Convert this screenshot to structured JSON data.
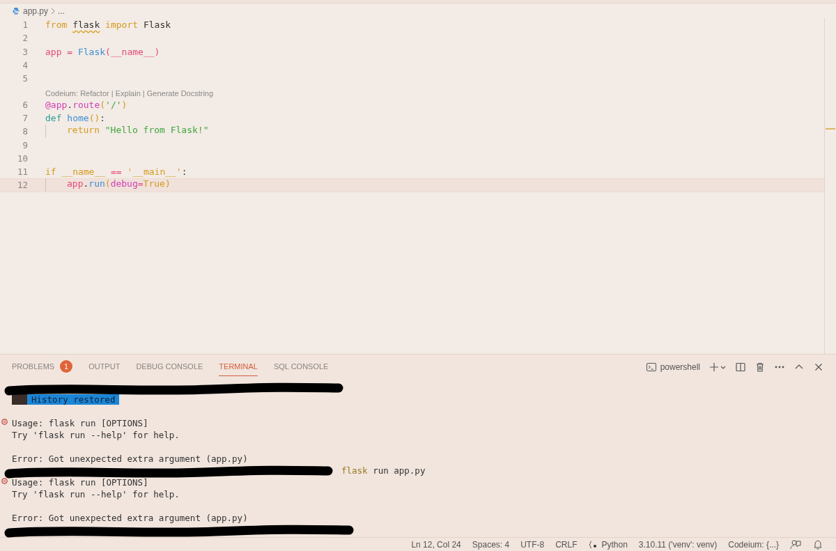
{
  "breadcrumb": {
    "file": "app.py",
    "rest": "..."
  },
  "editor": {
    "lines": [
      {
        "number": "1",
        "current": false,
        "tokens": [
          {
            "text": "from ",
            "kind": "keyword"
          },
          {
            "text": "flask",
            "kind": "warn"
          },
          {
            "text": " import ",
            "kind": "keyword"
          },
          {
            "text": "Flask",
            "kind": "plain"
          }
        ]
      },
      {
        "number": "2",
        "current": false
      },
      {
        "number": "3",
        "current": false,
        "tokens": [
          {
            "text": "app",
            "kind": "var"
          },
          {
            "text": " = ",
            "kind": "op"
          },
          {
            "text": "Flask",
            "kind": "class"
          },
          {
            "text": "(__name__)",
            "kind": "var"
          }
        ]
      },
      {
        "number": "4",
        "current": false
      },
      {
        "number": "5",
        "current": false
      },
      {
        "number": "6",
        "current": false,
        "codelens": "Codeium: Refactor | Explain | Generate Docstring",
        "tokens": [
          {
            "text": "@app",
            "kind": "decorator"
          },
          {
            "text": ".",
            "kind": "plain"
          },
          {
            "text": "route",
            "kind": "decorator"
          },
          {
            "text": "(",
            "kind": "paren"
          },
          {
            "text": "'/'",
            "kind": "string"
          },
          {
            "text": ")",
            "kind": "paren"
          }
        ]
      },
      {
        "number": "7",
        "current": false,
        "tokens": [
          {
            "text": "def ",
            "kind": "def"
          },
          {
            "text": "home",
            "kind": "func"
          },
          {
            "text": "()",
            "kind": "paren"
          },
          {
            "text": ":",
            "kind": "plain"
          }
        ]
      },
      {
        "number": "8",
        "current": false,
        "tokens": [
          {
            "kind": "indent"
          },
          {
            "text": "return ",
            "kind": "keyword"
          },
          {
            "text": "\"Hello from Flask!\"",
            "kind": "string"
          }
        ]
      },
      {
        "number": "9",
        "current": false
      },
      {
        "number": "10",
        "current": false
      },
      {
        "number": "11",
        "current": false,
        "tokens": [
          {
            "text": "if ",
            "kind": "keyword"
          },
          {
            "text": "__name__",
            "kind": "keyword"
          },
          {
            "text": " == ",
            "kind": "op"
          },
          {
            "text": "'__main__'",
            "kind": "keyword"
          },
          {
            "text": ":",
            "kind": "plain"
          }
        ]
      },
      {
        "number": "12",
        "current": true,
        "tokens": [
          {
            "kind": "indent"
          },
          {
            "text": "app",
            "kind": "var"
          },
          {
            "text": ".",
            "kind": "plain"
          },
          {
            "text": "run",
            "kind": "class"
          },
          {
            "text": "(",
            "kind": "paren"
          },
          {
            "text": "debug",
            "kind": "decorator"
          },
          {
            "text": "=",
            "kind": "op"
          },
          {
            "text": "True",
            "kind": "keyword"
          },
          {
            "text": ")",
            "kind": "paren"
          }
        ]
      }
    ]
  },
  "panel": {
    "tabs": [
      {
        "label": "PROBLEMS",
        "selected": false,
        "badge": "1"
      },
      {
        "label": "OUTPUT",
        "selected": false
      },
      {
        "label": "DEBUG CONSOLE",
        "selected": false
      },
      {
        "label": "TERMINAL",
        "selected": true
      },
      {
        "label": "SQL CONSOLE",
        "selected": false
      }
    ],
    "shell": "powershell",
    "terminal": [
      {
        "kind": "redacted"
      },
      {
        "kind": "notice",
        "text": "History restored"
      },
      {
        "kind": "blank"
      },
      {
        "kind": "error",
        "text": "Usage: flask run [OPTIONS]"
      },
      {
        "kind": "text",
        "text": "Try 'flask run --help' for help."
      },
      {
        "kind": "blank"
      },
      {
        "kind": "text",
        "text": "Error: Got unexpected extra argument (app.py)"
      },
      {
        "kind": "redacted",
        "tail": "flask run app.py"
      },
      {
        "kind": "error",
        "text": "Usage: flask run [OPTIONS]"
      },
      {
        "kind": "text",
        "text": "Try 'flask run --help' for help."
      },
      {
        "kind": "blank"
      },
      {
        "kind": "text",
        "text": "Error: Got unexpected extra argument (app.py)"
      },
      {
        "kind": "redacted"
      }
    ]
  },
  "status_bar": [
    "Ln 12, Col 24",
    "Spaces: 4",
    "UTF-8",
    "CRLF",
    "Python",
    "3.10.11 ('venv': venv)",
    "Codeium: {...}"
  ]
}
